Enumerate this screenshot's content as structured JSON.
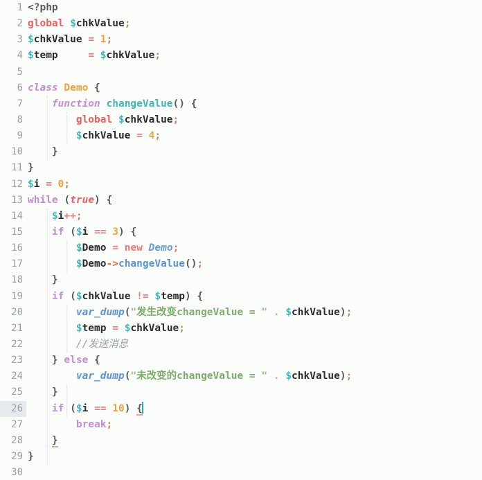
{
  "editor": {
    "language": "php",
    "background_color": "#fbfdfb",
    "active_line_number": 26,
    "total_lines": 30,
    "cursor": {
      "line": 26,
      "after_text": "{"
    },
    "colors": {
      "keyword_global": "#ef5c5c",
      "keyword_control": "#c48dd8",
      "variable_sigil": "#3cb8b8",
      "variable_name": "#2b2b2b",
      "number": "#f0a13c",
      "operator": "#ef7a7a",
      "class_name": "#f0a13c",
      "class_ref": "#6b9bd2",
      "method_def": "#3cb8b8",
      "method_call": "#5b93d6",
      "builtin_function": "#5b93d6",
      "string": "#7bad6a",
      "comment": "#9ba1a8",
      "gutter_text": "#9aa0a6",
      "active_line_gutter": "#e7eaec",
      "caret": "#2aa8b8",
      "bracket_match_underline": "#f0a090"
    },
    "lines": [
      {
        "n": "1",
        "text": "<?php"
      },
      {
        "n": "2",
        "text": "global $chkValue;"
      },
      {
        "n": "3",
        "text": "$chkValue = 1;"
      },
      {
        "n": "4",
        "text": "$temp     = $chkValue;"
      },
      {
        "n": "5",
        "text": ""
      },
      {
        "n": "6",
        "text": "class Demo {"
      },
      {
        "n": "7",
        "text": "    function changeValue() {"
      },
      {
        "n": "8",
        "text": "        global $chkValue;"
      },
      {
        "n": "9",
        "text": "        $chkValue = 4;"
      },
      {
        "n": "10",
        "text": "    }"
      },
      {
        "n": "11",
        "text": "}"
      },
      {
        "n": "12",
        "text": "$i = 0;"
      },
      {
        "n": "13",
        "text": "while (true) {"
      },
      {
        "n": "14",
        "text": "    $i++;"
      },
      {
        "n": "15",
        "text": "    if ($i == 3) {"
      },
      {
        "n": "16",
        "text": "        $Demo = new Demo;"
      },
      {
        "n": "17",
        "text": "        $Demo->changeValue();"
      },
      {
        "n": "18",
        "text": "    }"
      },
      {
        "n": "19",
        "text": "    if ($chkValue != $temp) {"
      },
      {
        "n": "20",
        "text": "        var_dump(\"发生改变changeValue = \" . $chkValue);"
      },
      {
        "n": "21",
        "text": "        $temp = $chkValue;"
      },
      {
        "n": "22",
        "text": "        //发送消息"
      },
      {
        "n": "23",
        "text": "    } else {"
      },
      {
        "n": "24",
        "text": "        var_dump(\"未改变的changeValue = \" . $chkValue);"
      },
      {
        "n": "25",
        "text": "    }"
      },
      {
        "n": "26",
        "text": "    if ($i == 10) {"
      },
      {
        "n": "27",
        "text": "        break;"
      },
      {
        "n": "28",
        "text": "    }"
      },
      {
        "n": "29",
        "text": "}"
      },
      {
        "n": "30",
        "text": ""
      }
    ]
  }
}
